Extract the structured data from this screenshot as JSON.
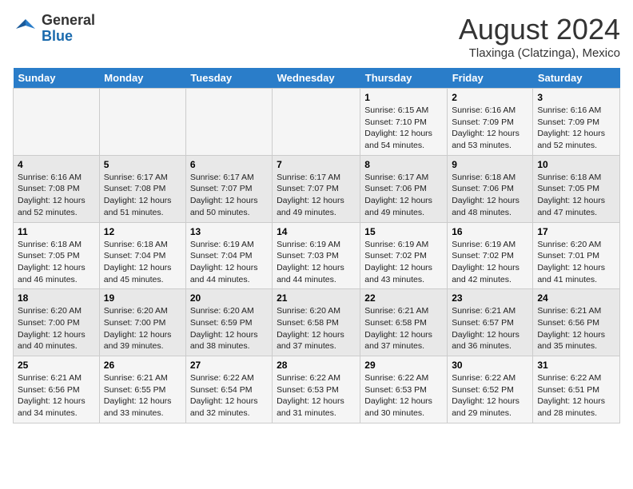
{
  "header": {
    "logo_general": "General",
    "logo_blue": "Blue",
    "month_title": "August 2024",
    "location": "Tlaxinga (Clatzinga), Mexico"
  },
  "days_of_week": [
    "Sunday",
    "Monday",
    "Tuesday",
    "Wednesday",
    "Thursday",
    "Friday",
    "Saturday"
  ],
  "weeks": [
    [
      {
        "num": "",
        "info": ""
      },
      {
        "num": "",
        "info": ""
      },
      {
        "num": "",
        "info": ""
      },
      {
        "num": "",
        "info": ""
      },
      {
        "num": "1",
        "info": "Sunrise: 6:15 AM\nSunset: 7:10 PM\nDaylight: 12 hours\nand 54 minutes."
      },
      {
        "num": "2",
        "info": "Sunrise: 6:16 AM\nSunset: 7:09 PM\nDaylight: 12 hours\nand 53 minutes."
      },
      {
        "num": "3",
        "info": "Sunrise: 6:16 AM\nSunset: 7:09 PM\nDaylight: 12 hours\nand 52 minutes."
      }
    ],
    [
      {
        "num": "4",
        "info": "Sunrise: 6:16 AM\nSunset: 7:08 PM\nDaylight: 12 hours\nand 52 minutes."
      },
      {
        "num": "5",
        "info": "Sunrise: 6:17 AM\nSunset: 7:08 PM\nDaylight: 12 hours\nand 51 minutes."
      },
      {
        "num": "6",
        "info": "Sunrise: 6:17 AM\nSunset: 7:07 PM\nDaylight: 12 hours\nand 50 minutes."
      },
      {
        "num": "7",
        "info": "Sunrise: 6:17 AM\nSunset: 7:07 PM\nDaylight: 12 hours\nand 49 minutes."
      },
      {
        "num": "8",
        "info": "Sunrise: 6:17 AM\nSunset: 7:06 PM\nDaylight: 12 hours\nand 49 minutes."
      },
      {
        "num": "9",
        "info": "Sunrise: 6:18 AM\nSunset: 7:06 PM\nDaylight: 12 hours\nand 48 minutes."
      },
      {
        "num": "10",
        "info": "Sunrise: 6:18 AM\nSunset: 7:05 PM\nDaylight: 12 hours\nand 47 minutes."
      }
    ],
    [
      {
        "num": "11",
        "info": "Sunrise: 6:18 AM\nSunset: 7:05 PM\nDaylight: 12 hours\nand 46 minutes."
      },
      {
        "num": "12",
        "info": "Sunrise: 6:18 AM\nSunset: 7:04 PM\nDaylight: 12 hours\nand 45 minutes."
      },
      {
        "num": "13",
        "info": "Sunrise: 6:19 AM\nSunset: 7:04 PM\nDaylight: 12 hours\nand 44 minutes."
      },
      {
        "num": "14",
        "info": "Sunrise: 6:19 AM\nSunset: 7:03 PM\nDaylight: 12 hours\nand 44 minutes."
      },
      {
        "num": "15",
        "info": "Sunrise: 6:19 AM\nSunset: 7:02 PM\nDaylight: 12 hours\nand 43 minutes."
      },
      {
        "num": "16",
        "info": "Sunrise: 6:19 AM\nSunset: 7:02 PM\nDaylight: 12 hours\nand 42 minutes."
      },
      {
        "num": "17",
        "info": "Sunrise: 6:20 AM\nSunset: 7:01 PM\nDaylight: 12 hours\nand 41 minutes."
      }
    ],
    [
      {
        "num": "18",
        "info": "Sunrise: 6:20 AM\nSunset: 7:00 PM\nDaylight: 12 hours\nand 40 minutes."
      },
      {
        "num": "19",
        "info": "Sunrise: 6:20 AM\nSunset: 7:00 PM\nDaylight: 12 hours\nand 39 minutes."
      },
      {
        "num": "20",
        "info": "Sunrise: 6:20 AM\nSunset: 6:59 PM\nDaylight: 12 hours\nand 38 minutes."
      },
      {
        "num": "21",
        "info": "Sunrise: 6:20 AM\nSunset: 6:58 PM\nDaylight: 12 hours\nand 37 minutes."
      },
      {
        "num": "22",
        "info": "Sunrise: 6:21 AM\nSunset: 6:58 PM\nDaylight: 12 hours\nand 37 minutes."
      },
      {
        "num": "23",
        "info": "Sunrise: 6:21 AM\nSunset: 6:57 PM\nDaylight: 12 hours\nand 36 minutes."
      },
      {
        "num": "24",
        "info": "Sunrise: 6:21 AM\nSunset: 6:56 PM\nDaylight: 12 hours\nand 35 minutes."
      }
    ],
    [
      {
        "num": "25",
        "info": "Sunrise: 6:21 AM\nSunset: 6:56 PM\nDaylight: 12 hours\nand 34 minutes."
      },
      {
        "num": "26",
        "info": "Sunrise: 6:21 AM\nSunset: 6:55 PM\nDaylight: 12 hours\nand 33 minutes."
      },
      {
        "num": "27",
        "info": "Sunrise: 6:22 AM\nSunset: 6:54 PM\nDaylight: 12 hours\nand 32 minutes."
      },
      {
        "num": "28",
        "info": "Sunrise: 6:22 AM\nSunset: 6:53 PM\nDaylight: 12 hours\nand 31 minutes."
      },
      {
        "num": "29",
        "info": "Sunrise: 6:22 AM\nSunset: 6:53 PM\nDaylight: 12 hours\nand 30 minutes."
      },
      {
        "num": "30",
        "info": "Sunrise: 6:22 AM\nSunset: 6:52 PM\nDaylight: 12 hours\nand 29 minutes."
      },
      {
        "num": "31",
        "info": "Sunrise: 6:22 AM\nSunset: 6:51 PM\nDaylight: 12 hours\nand 28 minutes."
      }
    ]
  ]
}
